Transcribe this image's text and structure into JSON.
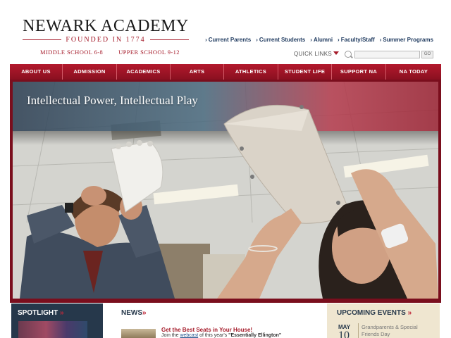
{
  "header": {
    "logo_title": "NEWARK ACADEMY",
    "founded": "FOUNDED IN 1774",
    "middle_school": "MIDDLE SCHOOL 6-8",
    "upper_school": "UPPER SCHOOL 9-12"
  },
  "utility_nav": [
    {
      "label": "Current Parents"
    },
    {
      "label": "Current Students"
    },
    {
      "label": "Alumni"
    },
    {
      "label": "Faculty/Staff"
    },
    {
      "label": "Summer Programs"
    }
  ],
  "quick_links": {
    "label": "QUICK LINKS"
  },
  "search": {
    "placeholder": "",
    "go_label": "GO"
  },
  "main_nav": [
    {
      "label": "ABOUT US"
    },
    {
      "label": "ADMISSION"
    },
    {
      "label": "ACADEMICS"
    },
    {
      "label": "ARTS"
    },
    {
      "label": "ATHLETICS"
    },
    {
      "label": "STUDENT LIFE"
    },
    {
      "label": "SUPPORT NA"
    },
    {
      "label": "NA TODAY"
    }
  ],
  "hero": {
    "caption": "Intellectual Power, Intellectual Play"
  },
  "spotlight": {
    "title": "SPOTLIGHT",
    "chevron": "»"
  },
  "news": {
    "title": "NEWS",
    "chevron": "»",
    "headline": "Get the Best Seats in Your House!",
    "body_prefix": "Join the ",
    "body_link": "webcast",
    "body_mid": " of this year's ",
    "body_bold": "\"Essentially Ellington\""
  },
  "events": {
    "title": "UPCOMING EVENTS",
    "chevron": "»",
    "month": "MAY",
    "day": "10",
    "description": "Grandparents & Special Friends Day"
  },
  "colors": {
    "brand_red": "#a51b2a",
    "nav_red": "#b3192d",
    "navy": "#26384b",
    "events_bg": "#efe6d0"
  }
}
